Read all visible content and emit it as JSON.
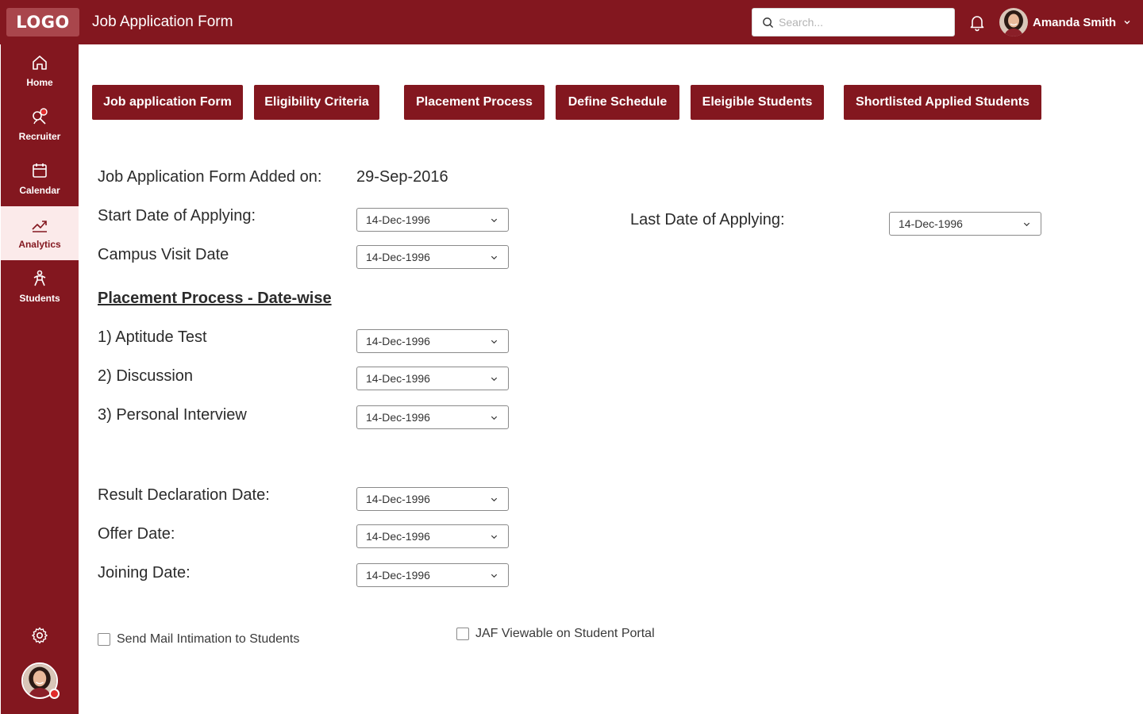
{
  "header": {
    "logo_text": "LOGO",
    "title": "Job Application Form",
    "search_placeholder": "Search...",
    "user_name": "Amanda Smith"
  },
  "sidebar": {
    "items": [
      {
        "label": "Home",
        "icon": "home-icon"
      },
      {
        "label": "Recruiter",
        "icon": "recruiter-icon"
      },
      {
        "label": "Calendar",
        "icon": "calendar-icon"
      },
      {
        "label": "Analytics",
        "icon": "analytics-icon",
        "active": true
      },
      {
        "label": "Students",
        "icon": "students-icon"
      }
    ]
  },
  "tabs": [
    {
      "label": "Job application Form"
    },
    {
      "label": "Eligibility Criteria"
    },
    {
      "label": "Placement Process"
    },
    {
      "label": "Define Schedule"
    },
    {
      "label": "Eleigible Students"
    },
    {
      "label": "Shortlisted Applied Students"
    }
  ],
  "form": {
    "added_on_label": "Job Application Form Added on:",
    "added_on_value": "29-Sep-2016",
    "start_date_label": "Start Date of Applying:",
    "start_date_value": "14-Dec-1996",
    "last_date_label": "Last Date of Applying:",
    "last_date_value": "14-Dec-1996",
    "campus_visit_label": "Campus Visit Date",
    "campus_visit_value": "14-Dec-1996",
    "section_title": "Placement Process - Date-wise",
    "steps": [
      {
        "label": "1) Aptitude Test",
        "value": "14-Dec-1996"
      },
      {
        "label": "2) Discussion",
        "value": "14-Dec-1996"
      },
      {
        "label": "3) Personal Interview",
        "value": "14-Dec-1996"
      }
    ],
    "result_label": "Result Declaration Date:",
    "result_value": "14-Dec-1996",
    "offer_label": "Offer Date:",
    "offer_value": "14-Dec-1996",
    "joining_label": "Joining Date:",
    "joining_value": "14-Dec-1996",
    "send_mail_label": "Send Mail Intimation to Students",
    "send_mail_checked": false,
    "jaf_viewable_label": "JAF Viewable on Student Portal",
    "jaf_viewable_checked": false
  },
  "colors": {
    "primary": "#83171f",
    "active_bg": "#fbeaea"
  }
}
